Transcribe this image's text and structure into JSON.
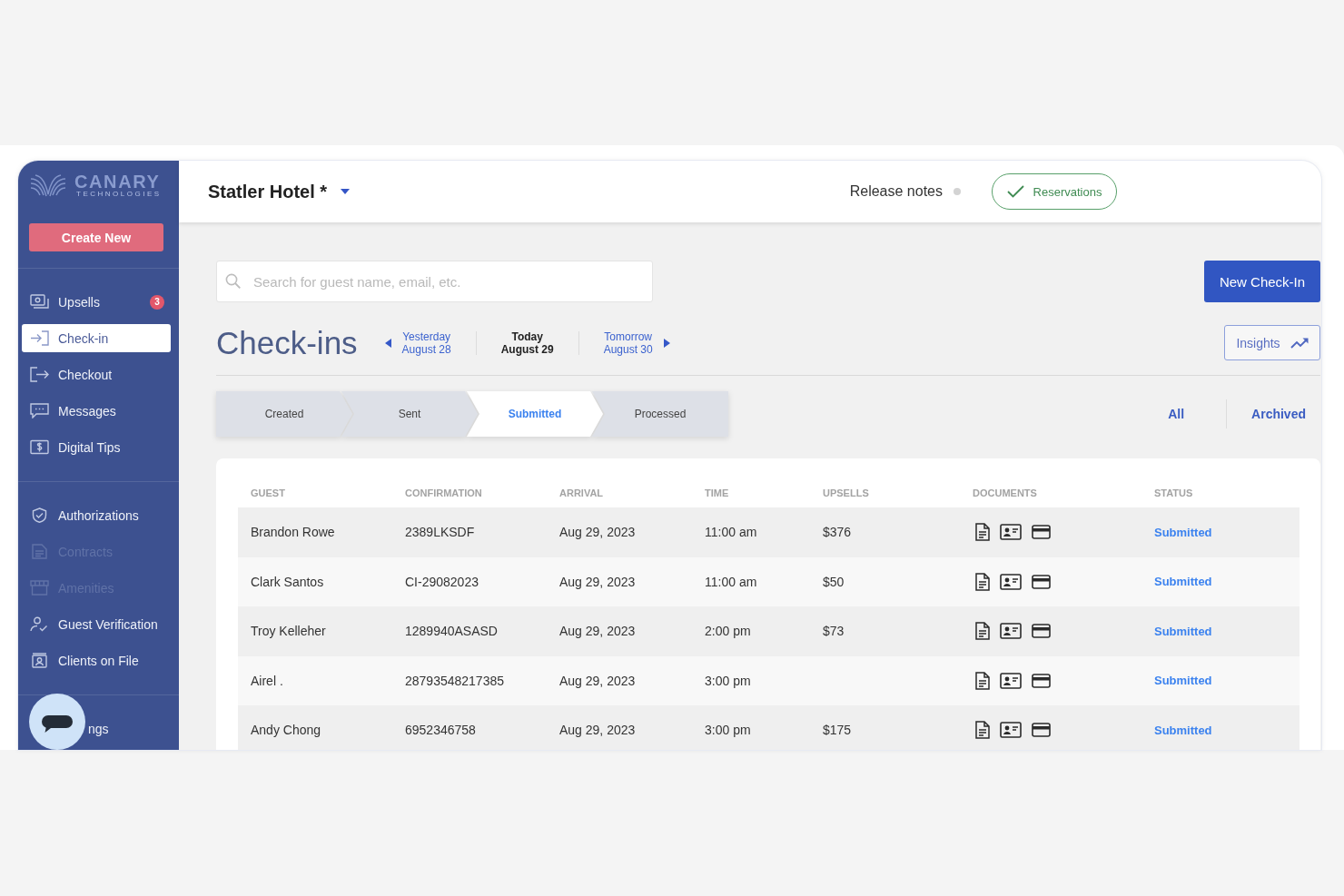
{
  "sidebar": {
    "logo": {
      "name": "CANARY",
      "tagline": "TECHNOLOGIES"
    },
    "create_button": "Create New",
    "groups": [
      {
        "items": [
          {
            "label": "Upsells",
            "selected": false,
            "disabled": false,
            "badge": "3"
          },
          {
            "label": "Check-in",
            "selected": true,
            "disabled": false
          },
          {
            "label": "Checkout",
            "selected": false,
            "disabled": false
          },
          {
            "label": "Messages",
            "selected": false,
            "disabled": false
          },
          {
            "label": "Digital Tips",
            "selected": false,
            "disabled": false
          }
        ]
      },
      {
        "items": [
          {
            "label": "Authorizations",
            "selected": false,
            "disabled": false
          },
          {
            "label": "Contracts",
            "selected": false,
            "disabled": true
          },
          {
            "label": "Amenities",
            "selected": false,
            "disabled": true
          },
          {
            "label": "Guest Verification",
            "selected": false,
            "disabled": false
          },
          {
            "label": "Clients on File",
            "selected": false,
            "disabled": false
          }
        ]
      }
    ],
    "footer_item": {
      "label": "ngs"
    }
  },
  "header": {
    "hotel": "Statler Hotel *",
    "release_notes": "Release notes",
    "reservations_button": "Reservations"
  },
  "toolbar": {
    "search": {
      "placeholder": "Search for guest name, email, etc."
    },
    "new_button": "New Check-In"
  },
  "page_title": "Check-ins",
  "date_nav": [
    {
      "day": "Yesterday",
      "date": "August 28",
      "selected": false
    },
    {
      "day": "Today",
      "date": "August 29",
      "selected": true
    },
    {
      "day": "Tomorrow",
      "date": "August 30",
      "selected": false
    }
  ],
  "insights_button": "Insights",
  "stages": [
    {
      "label": "Created",
      "selected": false
    },
    {
      "label": "Sent",
      "selected": false
    },
    {
      "label": "Submitted",
      "selected": true
    },
    {
      "label": "Processed",
      "selected": false
    }
  ],
  "filters": [
    "All",
    "Archived"
  ],
  "table": {
    "columns": [
      "GUEST",
      "CONFIRMATION",
      "ARRIVAL",
      "TIME",
      "UPSELLS",
      "DOCUMENTS",
      "STATUS"
    ],
    "rows": [
      {
        "guest": "Brandon Rowe",
        "confirmation": "2389LKSDF",
        "arrival": "Aug 29, 2023",
        "time": "11:00 am",
        "upsells": "$376",
        "status": "Submitted"
      },
      {
        "guest": "Clark Santos",
        "confirmation": "CI-29082023",
        "arrival": "Aug 29, 2023",
        "time": "11:00 am",
        "upsells": "$50",
        "status": "Submitted"
      },
      {
        "guest": "Troy Kelleher",
        "confirmation": "1289940ASASD",
        "arrival": "Aug 29, 2023",
        "time": "2:00 pm",
        "upsells": "$73",
        "status": "Submitted"
      },
      {
        "guest": "Airel .",
        "confirmation": "28793548217385",
        "arrival": "Aug 29, 2023",
        "time": "3:00 pm",
        "status": "Submitted"
      },
      {
        "guest": "Andy Chong",
        "confirmation": "6952346758",
        "arrival": "Aug 29, 2023",
        "time": "3:00 pm",
        "upsells": "$175",
        "status": "Submitted"
      }
    ]
  }
}
